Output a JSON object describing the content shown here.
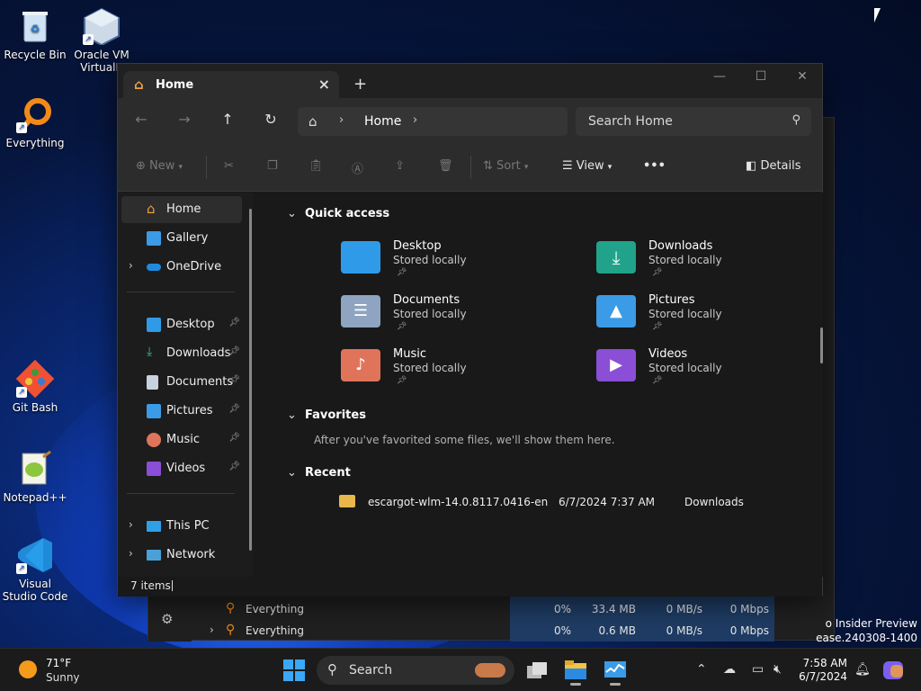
{
  "desktop": {
    "icons": [
      {
        "label": "Recycle Bin"
      },
      {
        "label": "Oracle VM VirtualB"
      },
      {
        "label": "Everything"
      },
      {
        "label": "Git Bash"
      },
      {
        "label": "Notepad++"
      },
      {
        "label": "Visual Studio Code"
      }
    ],
    "watermark_line1": "o Insider Preview",
    "watermark_line2": "ease.240308-1400"
  },
  "task_manager": {
    "rows": [
      {
        "name": "Everything",
        "cpu": "0%",
        "memory": "33.4 MB",
        "disk": "0 MB/s",
        "network": "0 Mbps"
      },
      {
        "name": "Everything",
        "cpu": "0%",
        "memory": "0.6 MB",
        "disk": "0 MB/s",
        "network": "0 Mbps"
      }
    ]
  },
  "explorer": {
    "tab_title": "Home",
    "address_crumb": "Home",
    "search_placeholder": "Search Home",
    "toolbar": {
      "new_label": "New",
      "sort_label": "Sort",
      "view_label": "View",
      "more_label": "•••",
      "details_label": "Details"
    },
    "nav": {
      "top": [
        {
          "label": "Home"
        },
        {
          "label": "Gallery"
        },
        {
          "label": "OneDrive"
        }
      ],
      "pinned": [
        {
          "label": "Desktop"
        },
        {
          "label": "Downloads"
        },
        {
          "label": "Documents"
        },
        {
          "label": "Pictures"
        },
        {
          "label": "Music"
        },
        {
          "label": "Videos"
        }
      ],
      "bottom": [
        {
          "label": "This PC"
        },
        {
          "label": "Network"
        }
      ]
    },
    "quick_access": {
      "title": "Quick access",
      "folders": [
        {
          "name": "Desktop",
          "status": "Stored locally",
          "color": "#2f9be8"
        },
        {
          "name": "Downloads",
          "status": "Stored locally",
          "color": "#20a38a"
        },
        {
          "name": "Documents",
          "status": "Stored locally",
          "color": "#8ea4c0"
        },
        {
          "name": "Pictures",
          "status": "Stored locally",
          "color": "#3b9be6"
        },
        {
          "name": "Music",
          "status": "Stored locally",
          "color": "#e0745a"
        },
        {
          "name": "Videos",
          "status": "Stored locally",
          "color": "#8a4fd6"
        }
      ]
    },
    "favorites": {
      "title": "Favorites",
      "empty_message": "After you've favorited some files, we'll show them here."
    },
    "recent": {
      "title": "Recent",
      "items": [
        {
          "name": "escargot-wlm-14.0.8117.0416-en",
          "date": "6/7/2024 7:37 AM",
          "location": "Downloads"
        }
      ]
    },
    "status_text": "7 items"
  },
  "taskbar": {
    "weather_temp": "71°F",
    "weather_cond": "Sunny",
    "search_label": "Search",
    "time": "7:58 AM",
    "date": "6/7/2024"
  }
}
